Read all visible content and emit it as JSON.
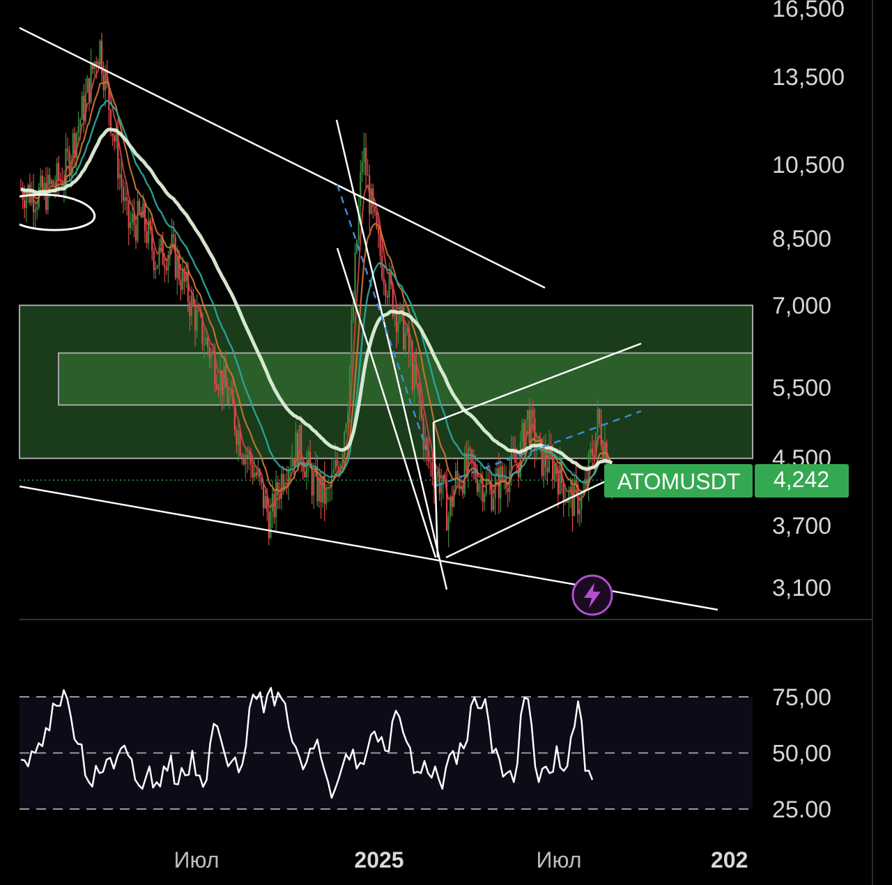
{
  "chart_data": [
    {
      "type": "candlestick",
      "symbol": "ATOMUSDT",
      "last_price_label": "4,242",
      "last_price": 4242,
      "y_scale": "log",
      "y_ticks": [
        "16,500",
        "13,500",
        "10,500",
        "8,500",
        "7,000",
        "5,500",
        "4,500",
        "3,700",
        "3,100"
      ],
      "y_tick_values": [
        16500,
        13500,
        10500,
        8500,
        7000,
        5500,
        4500,
        3700,
        3100
      ],
      "x_ticks": [
        {
          "label": "Июл",
          "bold": false
        },
        {
          "label": "2025",
          "bold": true
        },
        {
          "label": "Июл",
          "bold": false
        },
        {
          "label": "202",
          "bold": true
        }
      ],
      "zones": [
        {
          "name": "outer-demand-zone",
          "from": 4500,
          "to": 7000,
          "color": "#2f6e2f"
        },
        {
          "name": "inner-demand-zone",
          "from": 5250,
          "to": 6100,
          "color": "#3f8a3f"
        }
      ],
      "colors": {
        "up": "#3c8a3c",
        "down": "#e0484d",
        "ma_fast": "#d64545",
        "ma_mid": "#c8742d",
        "ma_slow": "#2aa59a",
        "ma_long": "#ffffff",
        "badge": "#35a852",
        "trendline": "#ffffff",
        "dashed_line": "#3a8fd6"
      },
      "price_path": [
        [
          0,
          9800
        ],
        [
          0.03,
          9600
        ],
        [
          0.06,
          10200
        ],
        [
          0.09,
          12600
        ],
        [
          0.11,
          15000
        ],
        [
          0.13,
          11500
        ],
        [
          0.15,
          8800
        ],
        [
          0.17,
          9000
        ],
        [
          0.19,
          8000
        ],
        [
          0.21,
          8300
        ],
        [
          0.23,
          7400
        ],
        [
          0.25,
          6600
        ],
        [
          0.27,
          6000
        ],
        [
          0.29,
          5400
        ],
        [
          0.31,
          4700
        ],
        [
          0.33,
          4300
        ],
        [
          0.35,
          3750
        ],
        [
          0.37,
          4400
        ],
        [
          0.39,
          4700
        ],
        [
          0.41,
          4200
        ],
        [
          0.43,
          4000
        ],
        [
          0.45,
          4600
        ],
        [
          0.46,
          5500
        ],
        [
          0.47,
          8000
        ],
        [
          0.48,
          11000
        ],
        [
          0.49,
          9500
        ],
        [
          0.5,
          8400
        ],
        [
          0.52,
          7200
        ],
        [
          0.54,
          6400
        ],
        [
          0.56,
          5200
        ],
        [
          0.57,
          4500
        ],
        [
          0.59,
          4200
        ],
        [
          0.6,
          3800
        ],
        [
          0.61,
          4200
        ],
        [
          0.63,
          4400
        ],
        [
          0.66,
          4100
        ],
        [
          0.68,
          4300
        ],
        [
          0.7,
          4500
        ],
        [
          0.71,
          5100
        ],
        [
          0.73,
          4500
        ],
        [
          0.75,
          4400
        ],
        [
          0.77,
          4000
        ],
        [
          0.79,
          4000
        ],
        [
          0.8,
          4500
        ],
        [
          0.81,
          5000
        ],
        [
          0.82,
          4700
        ],
        [
          0.83,
          4242
        ]
      ]
    },
    {
      "type": "line",
      "indicator": "oscillator",
      "y_ticks": [
        "75,00",
        "50,00",
        "25.00"
      ],
      "y_tick_values": [
        75,
        50,
        25
      ],
      "band": [
        30,
        70
      ],
      "values": [
        47,
        44,
        50,
        53,
        60,
        71,
        78,
        66,
        54,
        40,
        35,
        41,
        47,
        43,
        52,
        49,
        38,
        34,
        44,
        37,
        44,
        49,
        36,
        40,
        51,
        40,
        38,
        63,
        56,
        44,
        48,
        45,
        70,
        74,
        68,
        79,
        77,
        72,
        55,
        48,
        46,
        52,
        48,
        37,
        34,
        44,
        47,
        43,
        45,
        58,
        55,
        51,
        64,
        66,
        55,
        41,
        41,
        41,
        44,
        34,
        49,
        45,
        52,
        71,
        70,
        74,
        50,
        47,
        41,
        37,
        67,
        74,
        44,
        43,
        41,
        53,
        42,
        57,
        73,
        42,
        38
      ]
    }
  ]
}
